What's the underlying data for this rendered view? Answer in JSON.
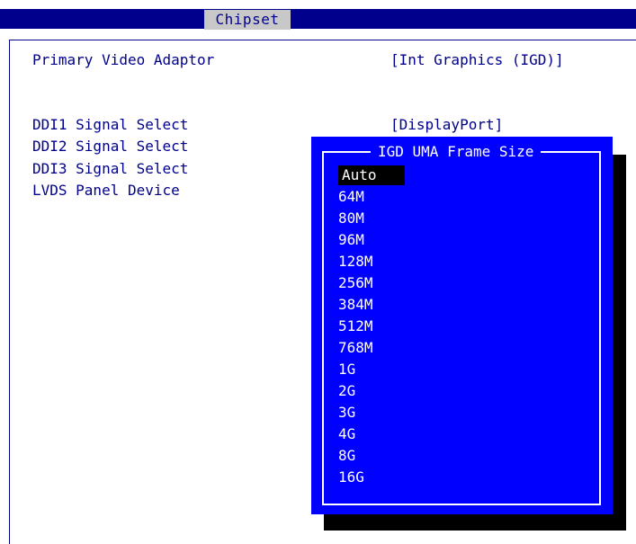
{
  "header": {
    "tab_label": "Chipset"
  },
  "settings": [
    {
      "label": "Primary Video Adaptor",
      "value": "[Int Graphics (IGD)]"
    },
    {
      "label": "IGD UMA Frame Size",
      "value": "[Auto]"
    },
    {
      "label": "DDI1 Signal Select",
      "value": "[DisplayPort]"
    },
    {
      "label": "DDI2 Signal Select",
      "value": ""
    },
    {
      "label": "DDI3 Signal Select",
      "value": ""
    },
    {
      "label": "LVDS Panel Device",
      "value": ""
    }
  ],
  "popup": {
    "title": "IGD UMA Frame Size",
    "options": [
      "Auto",
      "64M",
      "80M",
      "96M",
      "128M",
      "256M",
      "384M",
      "512M",
      "768M",
      "1G",
      "2G",
      "3G",
      "4G",
      "8G",
      "16G"
    ],
    "selected": "Auto"
  },
  "colors": {
    "bios_blue": "#00008c",
    "popup_blue": "#0000ff",
    "tab_gray": "#c8c8c8"
  }
}
